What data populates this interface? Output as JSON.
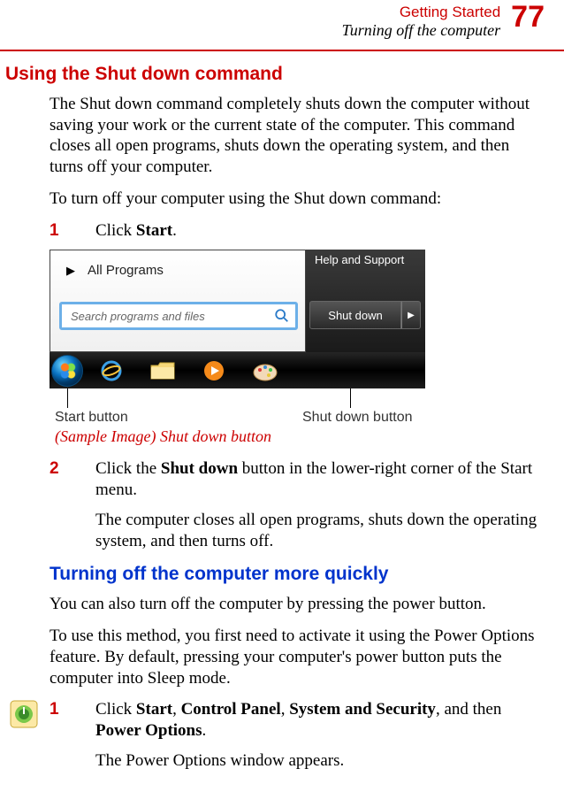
{
  "header": {
    "chapter": "Getting Started",
    "section": "Turning off the computer",
    "page": "77"
  },
  "h1": "Using the Shut down command",
  "p1": "The Shut down command completely shuts down the computer without saving your work or the current state of the computer. This command closes all open programs, shuts down the operating system, and then turns off your computer.",
  "p2": "To turn off your computer using the Shut down command:",
  "step1": {
    "num": "1",
    "pre": "Click ",
    "bold": "Start",
    "post": "."
  },
  "figure": {
    "all_programs": "All Programs",
    "search_placeholder": "Search programs and files",
    "help": "Help and Support",
    "shutdown": "Shut down",
    "callout_start": "Start button",
    "callout_shutdown": "Shut down button",
    "caption": "(Sample Image) Shut down button"
  },
  "step2": {
    "num": "2",
    "pre": "Click the ",
    "bold": "Shut down",
    "post": " button in the lower-right corner of the Start menu."
  },
  "p3": "The computer closes all open programs, shuts down the operating system, and then turns off.",
  "h2": "Turning off the computer more quickly",
  "p4": "You can also turn off the computer by pressing the power button.",
  "p5": "To use this method, you first need to activate it using the Power Options feature. By default, pressing your computer's power button puts the computer into Sleep mode.",
  "step3": {
    "num": "1",
    "pre": "Click ",
    "b1": "Start",
    "c1": ", ",
    "b2": "Control Panel",
    "c2": ", ",
    "b3": "System and Security",
    "c3": ", and then ",
    "b4": "Power Options",
    "post": "."
  },
  "p6": "The Power Options window appears."
}
